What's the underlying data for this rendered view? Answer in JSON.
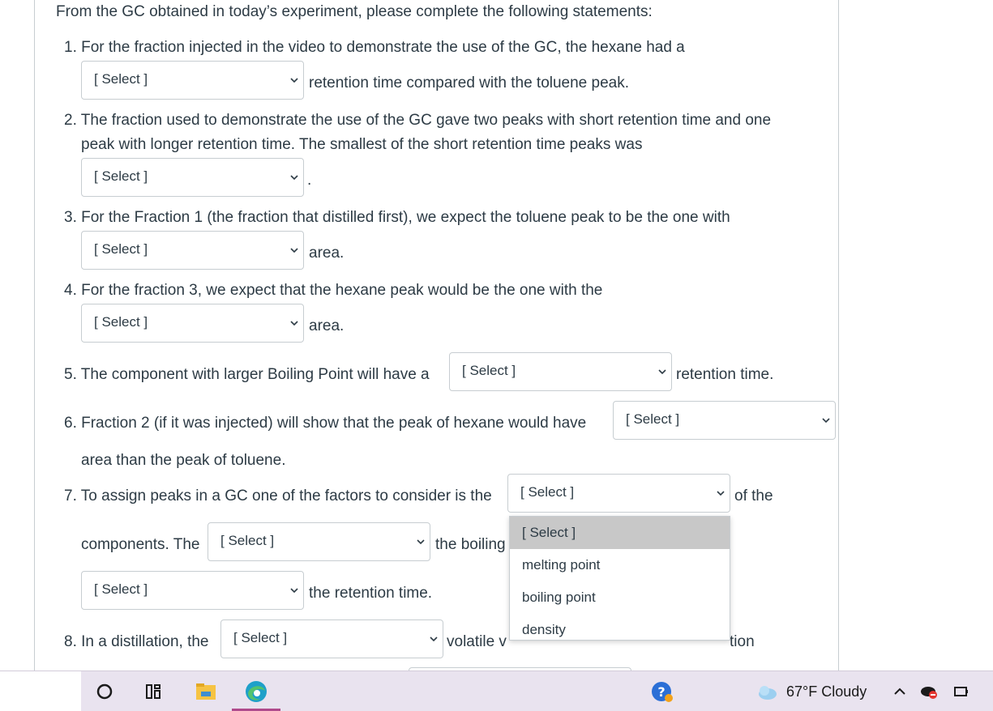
{
  "header": {
    "intro": "From the GC obtained in today’s experiment, please complete the following statements:"
  },
  "select_placeholder": "[ Select ]",
  "q1": {
    "line1": "1. For the fraction injected in the video to demonstrate the use of the GC, the hexane had a",
    "after": "retention time compared with the toluene peak."
  },
  "q2": {
    "line1": "2. The fraction used to demonstrate the use of the GC gave two peaks with short retention time and one",
    "line2": "peak with longer retention time. The smallest of the short retention time peaks was",
    "after": "."
  },
  "q3": {
    "line1": "3. For the Fraction 1 (the fraction that distilled first), we expect the toluene peak to be the one with",
    "after": "area."
  },
  "q4": {
    "line1": "4. For the fraction 3, we expect that the hexane peak would be the one with the",
    "after": "area."
  },
  "q5": {
    "before": "5. The component with larger Boiling Point will have a",
    "after": "retention time."
  },
  "q6": {
    "before": "6. Fraction 2 (if it was injected) will show that the peak of hexane would have",
    "line2": "area than the peak of toluene."
  },
  "q7": {
    "before": "7. To assign peaks in a GC one of the factors to consider is the",
    "after": "of the",
    "components_prefix": "components. The",
    "mid_text": "the boiling",
    "after_last": "the retention time."
  },
  "q8": {
    "before": "8. In a distillation, the",
    "after_visible": "volatile v",
    "tail_visible": "tion"
  },
  "dropdown_open": {
    "options": [
      "[ Select ]",
      "melting point",
      "boiling point",
      "density"
    ],
    "highlighted_index": 0
  },
  "taskbar": {
    "weather": "67°F  Cloudy",
    "icons": [
      "start-circle-icon",
      "task-view-icon",
      "file-explorer-icon",
      "edge-icon",
      "help-icon",
      "cloud-icon",
      "chevron-up-icon",
      "network-icon",
      "battery-icon"
    ]
  },
  "colors": {
    "text": "#2d3b45",
    "border": "#c7cdd1",
    "highlight": "#c8c8c8",
    "taskbar": "#e9e3ef",
    "edge_accent": "#b04a8c"
  }
}
